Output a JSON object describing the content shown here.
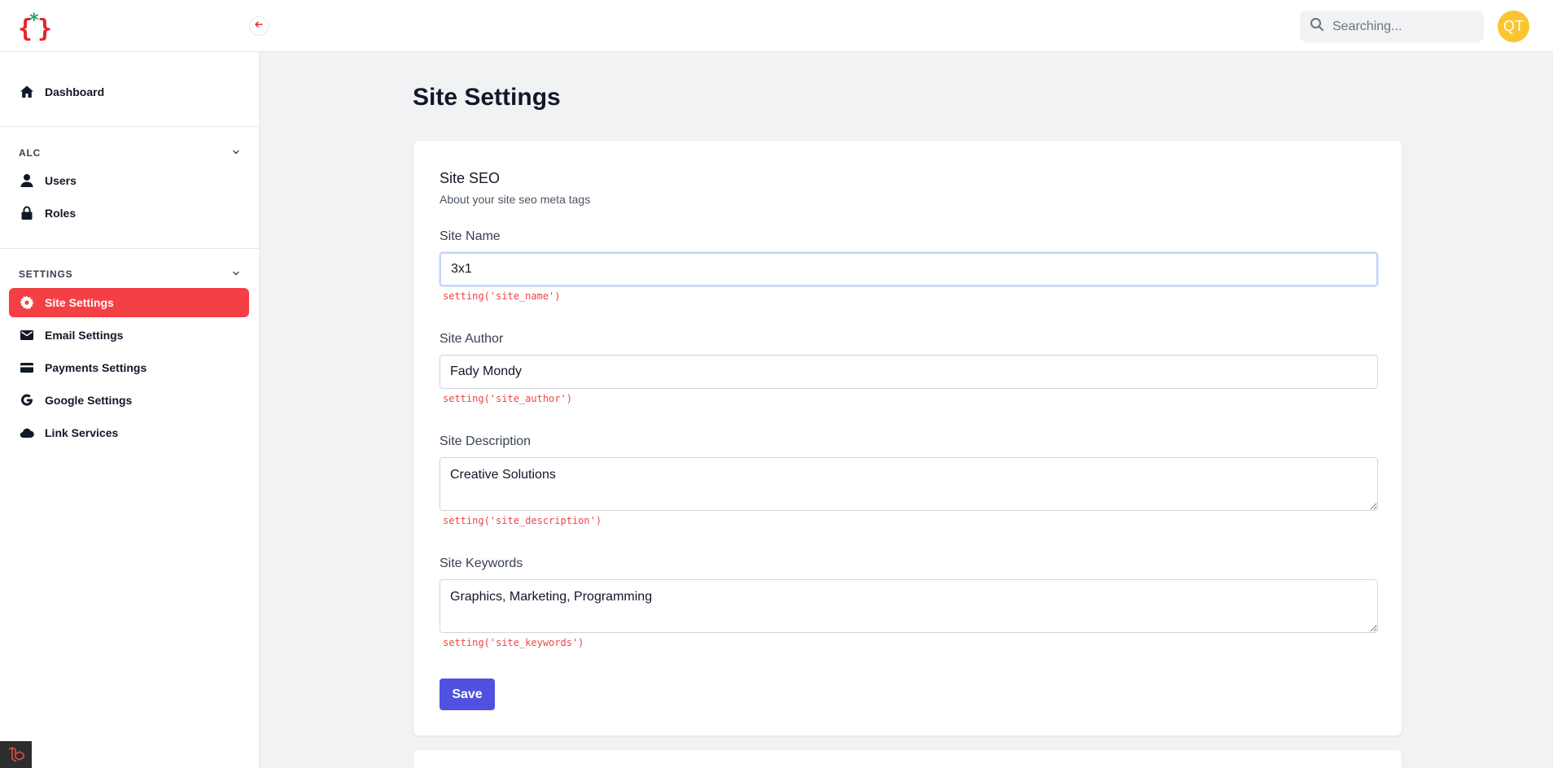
{
  "search": {
    "placeholder": "Searching..."
  },
  "user": {
    "initials": "QT"
  },
  "sidebar": {
    "dashboard": "Dashboard",
    "sections": [
      {
        "title": "ALC",
        "items": [
          "Users",
          "Roles"
        ]
      },
      {
        "title": "SETTINGS",
        "items": [
          "Site Settings",
          "Email Settings",
          "Payments Settings",
          "Google Settings",
          "Link Services"
        ]
      }
    ],
    "active_item": "Site Settings"
  },
  "page": {
    "title": "Site Settings"
  },
  "card": {
    "title": "Site SEO",
    "subtitle": "About your site seo meta tags",
    "fields": [
      {
        "label": "Site Name",
        "value": "3x1",
        "hint": "setting('site_name')"
      },
      {
        "label": "Site Author",
        "value": "Fady Mondy",
        "hint": "setting('site_author')"
      },
      {
        "label": "Site Description",
        "value": "Creative Solutions",
        "hint": "setting('site_description')"
      },
      {
        "label": "Site Keywords",
        "value": "Graphics, Marketing, Programming",
        "hint": "setting('site_keywords')"
      }
    ],
    "save_label": "Save"
  },
  "colors": {
    "active": "#f43f45",
    "primary": "#4f52e0",
    "avatar": "#fbc531",
    "hint": "#ef4444"
  },
  "icons": [
    "logo-icon",
    "arrow-left-icon",
    "search-icon",
    "home-icon",
    "chevron-down-icon",
    "user-icon",
    "lock-icon",
    "gear-icon",
    "mail-icon",
    "credit-card-icon",
    "google-icon",
    "cloud-icon",
    "laravel-icon"
  ]
}
